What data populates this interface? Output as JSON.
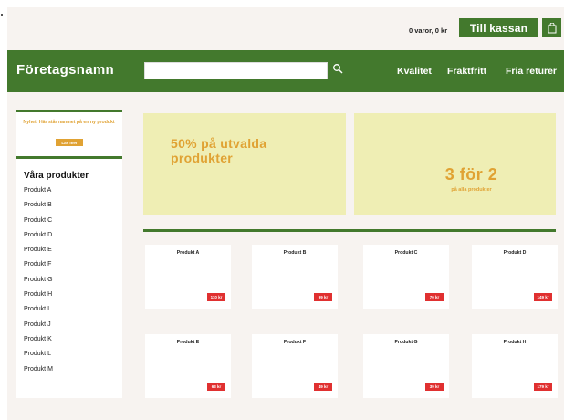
{
  "topbar": {
    "cart_summary": "0 varor, 0 kr",
    "checkout_label": "Till kassan",
    "bag_icon": "shopping-bag-icon"
  },
  "header": {
    "brand": "Företagsnamn",
    "search_placeholder": "",
    "search_icon": "search-icon",
    "nav": [
      "Kvalitet",
      "Fraktfritt",
      "Fria returer"
    ]
  },
  "sidebar": {
    "promo_text": "Nyhet: Här står namnet på en ny produkt",
    "promo_button": "Läs mer",
    "title": "Våra produkter",
    "products": [
      "Produkt A",
      "Produkt B",
      "Produkt C",
      "Produkt D",
      "Produkt E",
      "Produkt F",
      "Produkt G",
      "Produkt H",
      "Produkt I",
      "Produkt J",
      "Produkt K",
      "Produkt L",
      "Produkt M"
    ]
  },
  "banners": {
    "left": "50% på utvalda produkter",
    "right_big": "3 för 2",
    "right_small": "på alla produkter"
  },
  "products": [
    {
      "name": "Produkt A",
      "price": "110 kr"
    },
    {
      "name": "Produkt B",
      "price": "99 kr"
    },
    {
      "name": "Produkt C",
      "price": "70 kr"
    },
    {
      "name": "Produkt D",
      "price": "149 kr"
    },
    {
      "name": "Produkt E",
      "price": "63 kr"
    },
    {
      "name": "Produkt F",
      "price": "49 kr"
    },
    {
      "name": "Produkt  G",
      "price": "39 kr"
    },
    {
      "name": "Produkt H",
      "price": "179 kr"
    }
  ],
  "colors": {
    "brand_green": "#43792d",
    "accent_orange": "#e0a233",
    "banner_bg": "#efeeb4",
    "price_red": "#e03030",
    "page_bg": "#f7f3f0"
  }
}
